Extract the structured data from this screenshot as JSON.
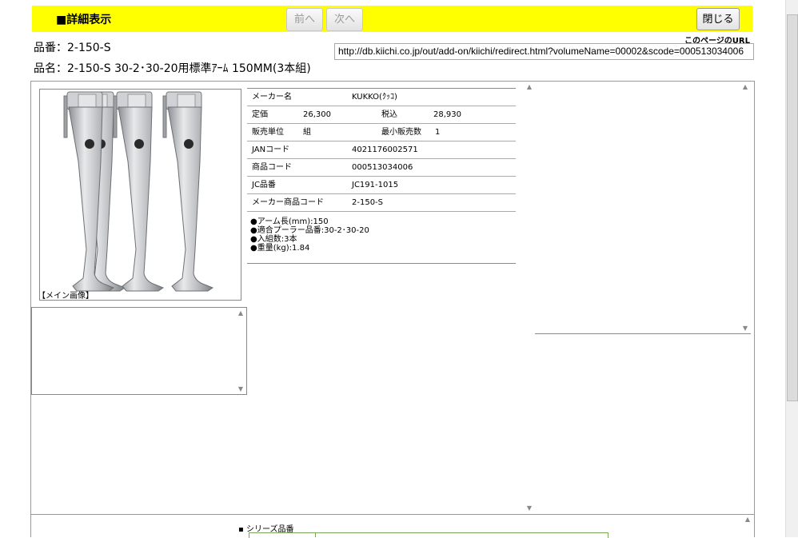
{
  "header": {
    "title": "■詳細表示",
    "prev_label": "前へ",
    "next_label": "次へ",
    "close_label": "閉じる"
  },
  "page_url": {
    "label": "このページのURL",
    "value": "http://db.kiichi.co.jp/out/add-on/kiichi/redirect.html?volumeName=00002&scode=000513034006"
  },
  "product": {
    "hinban": "品番：2-150-S",
    "hinmei": "品名：2-150-S 30-2･30-20用標準ｱｰﾑ 150MM(3本組)"
  },
  "image": {
    "caption": "【メイン画像】"
  },
  "spec": {
    "maker_label": "メーカー名",
    "maker_value": "KUKKO(ｸｯｺ)",
    "price_label": "定価",
    "price_value": "26,300",
    "tax_label": "税込",
    "tax_value": "28,930",
    "unit_label": "販売単位",
    "unit_value": "組",
    "min_label": "最小販売数",
    "min_value": "1",
    "jan_label": "JANコード",
    "jan_value": "4021176002571",
    "code_label": "商品コード",
    "code_value": "000513034006",
    "jc_label": "JC品番",
    "jc_value": "JC191-1015",
    "maker_code_label": "メーカー商品コード",
    "maker_code_value": "2-150-S"
  },
  "notes": [
    "●アーム長(mm):150",
    "●適合プーラー品番:30-2･30-20",
    "●入組数:3本",
    "●重量(kg):1.84"
  ],
  "series": {
    "label": "シリーズ品番"
  }
}
